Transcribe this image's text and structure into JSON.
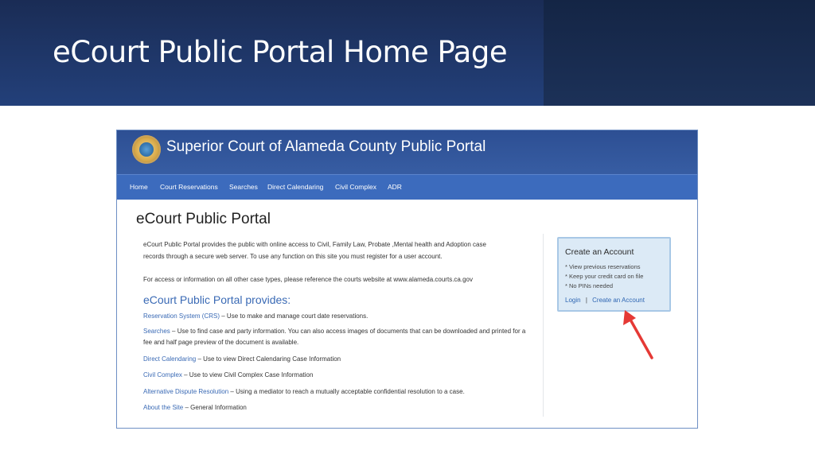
{
  "slide": {
    "title": "eCourt Public Portal Home Page"
  },
  "portal": {
    "site_title": "Superior Court of Alameda County Public Portal",
    "nav": [
      "Home",
      "Court Reservations",
      "Searches",
      "Direct Calendaring",
      "Civil Complex",
      "ADR"
    ],
    "page_heading": "eCourt Public Portal",
    "intro_line1": "eCourt Public Portal provides the public with online access to Civil, Family Law, Probate ,Mental health and Adoption case",
    "intro_line2": "records through a secure web server. To use any function on this site you must register for a user account.",
    "other_cases": "For access or information on all other case types, please reference the courts website at www.alameda.courts.ca.gov",
    "provides_heading": "eCourt Public Portal provides:",
    "services": [
      {
        "link": "Reservation System (CRS)",
        "desc": " – Use to make and manage court date reservations."
      },
      {
        "link": "Searches",
        "desc": " – Use to find case and party information. You can also access images of documents that can be downloaded and printed for a fee and half page preview of the document is available."
      },
      {
        "link": "Direct Calendaring",
        "desc": " – Use to view Direct Calendaring Case Information"
      },
      {
        "link": "Civil Complex",
        "desc": " – Use to view Civil Complex Case Information"
      },
      {
        "link": "Alternative Dispute Resolution",
        "desc": " – Using a mediator to reach a mutually acceptable confidential resolution to a case."
      },
      {
        "link": "About the Site",
        "desc": " – General Information"
      }
    ],
    "account_box": {
      "title": "Create an Account",
      "bullets": [
        "* View previous reservations",
        "* Keep your credit card on file",
        "* No PINs needed"
      ],
      "login": "Login",
      "separator": "|",
      "create": "Create an Account"
    }
  },
  "colors": {
    "slide_header": "#23407a",
    "portal_bar": "#2d4f93",
    "nav_bar": "#3c6bbd",
    "link": "#3a6ab5",
    "arrow": "#e53935"
  }
}
